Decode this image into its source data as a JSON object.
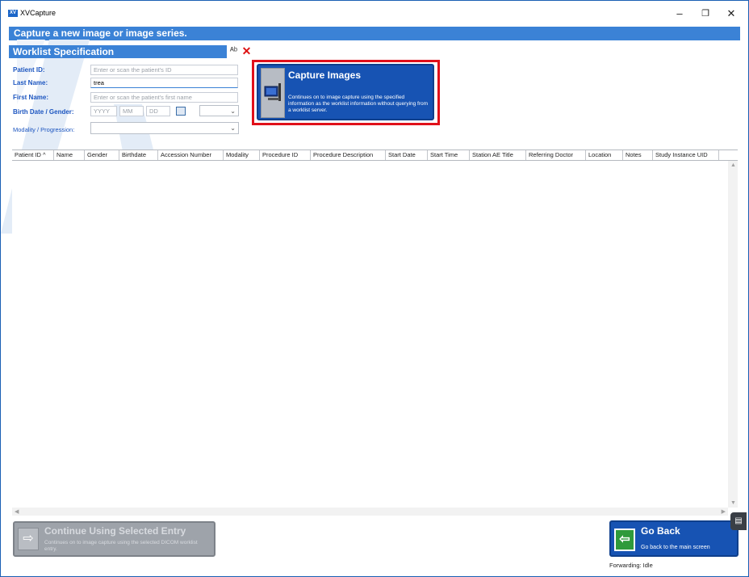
{
  "window": {
    "title": "XVCapture",
    "app_icon_text": "XV",
    "minimize": "–",
    "maximize": "❐",
    "close": "✕"
  },
  "banner": {
    "text": "Capture a new image or image series."
  },
  "worklist": {
    "section_title": "Worklist Specification",
    "tool_icon_glyph": "ᴬᵇ",
    "clear_glyph": "✕",
    "patient_id": {
      "label": "Patient ID:",
      "placeholder": "Enter or scan the patient's ID",
      "value": ""
    },
    "last_name": {
      "label": "Last Name:",
      "value": "trea"
    },
    "first_name": {
      "label": "First Name:",
      "placeholder": "Enter or scan the patient's first name",
      "value": ""
    },
    "birth_date_gender": {
      "label": "Birth Date / Gender:",
      "year_placeholder": "YYYY",
      "month_placeholder": "MM",
      "day_placeholder": "DD",
      "gender_value": ""
    },
    "modality": {
      "label": "Modality / Progression:",
      "value": ""
    }
  },
  "capture_button": {
    "title": "Capture Images",
    "description": "Continues on to image capture using the specified information as the worklist information without querying from a worklist server."
  },
  "grid": {
    "columns": [
      "Patient ID",
      "Name",
      "Gender",
      "Birthdate",
      "Accession Number",
      "Modality",
      "Procedure ID",
      "Procedure Description",
      "Start Date",
      "Start Time",
      "Station AE Title",
      "Referring Doctor",
      "Location",
      "Notes",
      "Study Instance UID"
    ],
    "sort_indicator": "^",
    "rows": []
  },
  "continue_button": {
    "title": "Continue Using Selected Entry",
    "description": "Continues on to image capture using the selected DICOM worklist entry."
  },
  "goback_button": {
    "title": "Go Back",
    "description": "Go back to the main screen"
  },
  "status": {
    "text": "Forwarding: Idle"
  },
  "colors": {
    "accent": "#3b82d6",
    "button_blue": "#1753b3",
    "highlight_red": "#e0101a",
    "disabled_gray": "#9ea3aa",
    "back_green": "#2f9a3b"
  },
  "icons": {
    "capture": "camera-monitor-icon",
    "continue": "arrow-right-icon",
    "goback": "arrow-left-icon",
    "calendar": "calendar-icon"
  }
}
